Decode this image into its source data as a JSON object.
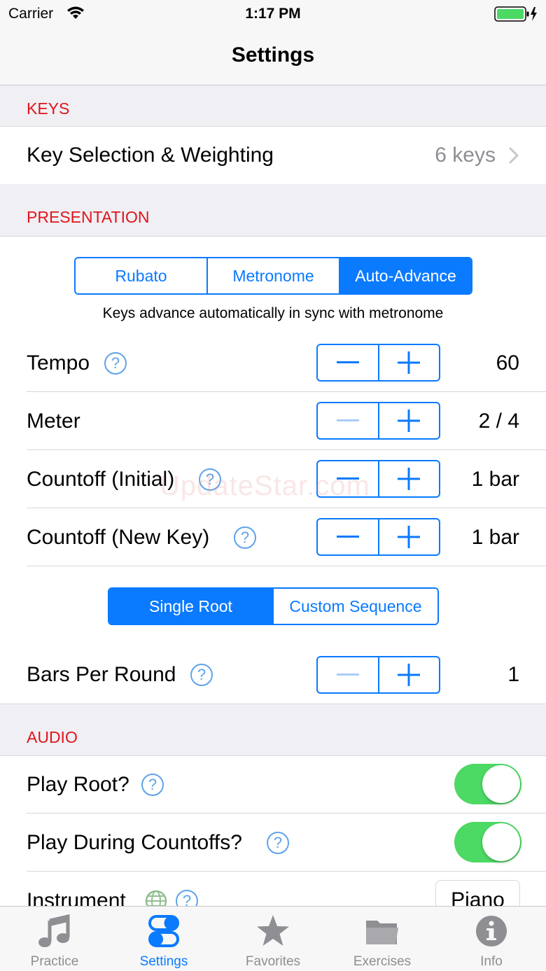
{
  "status_bar": {
    "carrier": "Carrier",
    "time": "1:17 PM"
  },
  "nav": {
    "title": "Settings"
  },
  "sections": {
    "keys": {
      "header": "KEYS",
      "row": {
        "label": "Key Selection & Weighting",
        "value": "6 keys"
      }
    },
    "presentation": {
      "header": "PRESENTATION",
      "mode_segments": [
        "Rubato",
        "Metronome",
        "Auto-Advance"
      ],
      "mode_selected": "Auto-Advance",
      "mode_caption": "Keys advance automatically in sync with metronome",
      "tempo": {
        "label": "Tempo",
        "value": "60"
      },
      "meter": {
        "label": "Meter",
        "value": "2 / 4"
      },
      "countoff_initial": {
        "label": "Countoff (Initial)",
        "value": "1 bar"
      },
      "countoff_new_key": {
        "label": "Countoff (New Key)",
        "value": "1 bar"
      },
      "root_segments": [
        "Single Root",
        "Custom Sequence"
      ],
      "root_selected": "Single Root",
      "bars_per_round": {
        "label": "Bars Per Round",
        "value": "1"
      }
    },
    "audio": {
      "header": "AUDIO",
      "play_root": {
        "label": "Play Root?",
        "on": true
      },
      "play_during_countoffs": {
        "label": "Play During Countoffs?",
        "on": true
      },
      "instrument": {
        "label": "Instrument",
        "value": "Piano"
      }
    }
  },
  "watermark": "UpdateStar.com",
  "tab_bar": {
    "tabs": [
      {
        "label": "Practice",
        "icon": "music-note-icon"
      },
      {
        "label": "Settings",
        "icon": "toggles-icon"
      },
      {
        "label": "Favorites",
        "icon": "star-icon"
      },
      {
        "label": "Exercises",
        "icon": "folder-icon"
      },
      {
        "label": "Info",
        "icon": "info-icon"
      }
    ],
    "active": "Settings"
  },
  "colors": {
    "accent": "#0a7aff",
    "section_header_text": "#e0151b",
    "toggle_on": "#4cd964",
    "help_icon": "#5ea3ea"
  }
}
